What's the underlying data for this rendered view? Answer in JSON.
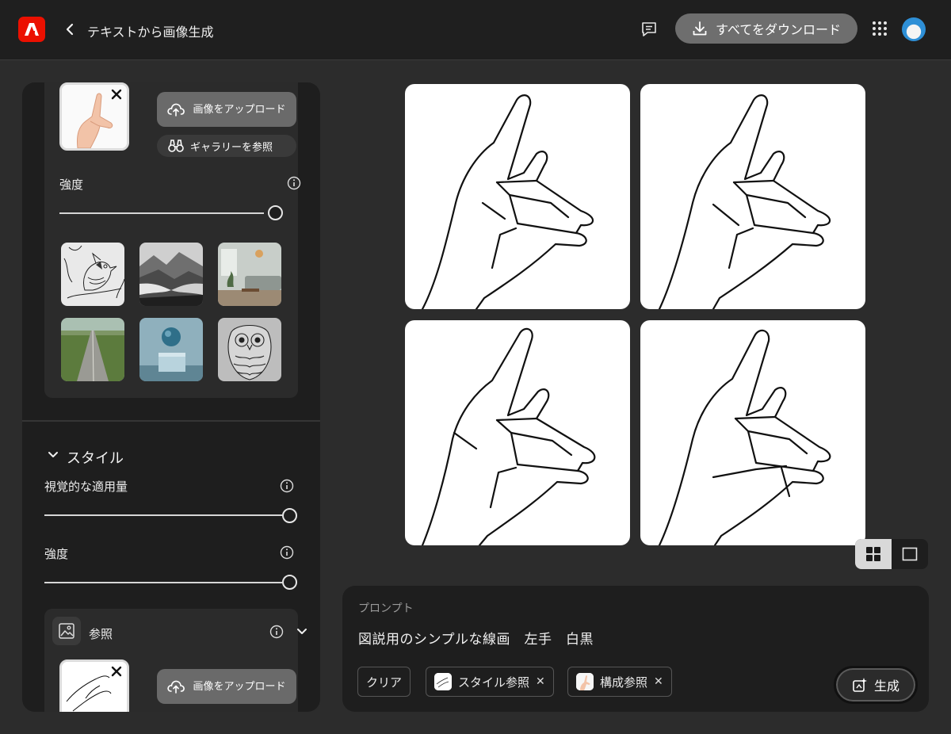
{
  "header": {
    "title": "テキストから画像生成",
    "download_all_label": "すべてをダウンロード"
  },
  "composition": {
    "upload_label": "画像をアップロード",
    "gallery_label": "ギャラリーを参照",
    "strength_label": "強度",
    "strength_value": 1.0,
    "presets": [
      "bird-line-art",
      "misty-mountains",
      "living-room",
      "rural-road",
      "blue-sphere-pedestal",
      "owl-line-art"
    ]
  },
  "style": {
    "title": "スタイル",
    "visual_intensity_label": "視覚的な適用量",
    "visual_intensity_value": 1.0,
    "strength_label": "強度",
    "strength_value": 1.0,
    "reference": {
      "label": "参照",
      "upload_label": "画像をアップロード"
    }
  },
  "results": {
    "count": 4,
    "view_modes": [
      "grid-view",
      "single-view"
    ],
    "selected_view": "grid-view"
  },
  "prompt": {
    "label": "プロンプト",
    "text": "図説用のシンプルな線画　左手　白黒",
    "clear_label": "クリア",
    "chips": [
      {
        "label": "スタイル参照"
      },
      {
        "label": "構成参照"
      }
    ],
    "generate_label": "生成"
  },
  "colors": {
    "brand": "#eb1000",
    "panel_bg": "#1e1e1e",
    "page_bg": "#2c2c2c"
  }
}
